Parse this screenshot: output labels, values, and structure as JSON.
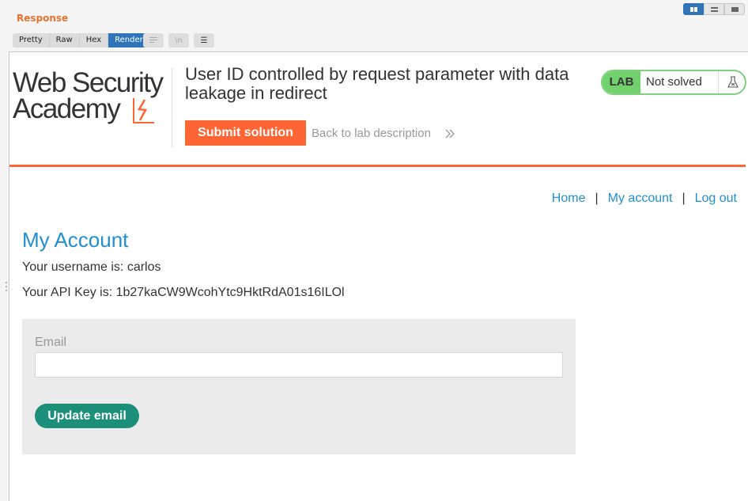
{
  "panel": {
    "title": "Response",
    "tabs": [
      "Pretty",
      "Raw",
      "Hex",
      "Render"
    ],
    "active_tab": "Render",
    "tool_icons": [
      "wrap-lines-icon",
      "newline-icon",
      "menu-icon"
    ],
    "tool_glyphs": {
      "newline": "\\n",
      "menu": "☰"
    },
    "view_icons": [
      "split-horizontal-icon",
      "split-vertical-icon",
      "single-pane-icon"
    ]
  },
  "lab": {
    "logo_line1": "Web Security",
    "logo_line2": "Academy",
    "title": "User ID controlled by request parameter with data leakage in redirect",
    "submit_label": "Submit solution",
    "back_label": "Back to lab description",
    "badge": "LAB",
    "status": "Not solved",
    "accent": "#ff6633",
    "badge_color": "#70d16d"
  },
  "nav": {
    "home": "Home",
    "separator": "|",
    "my_account": "My account",
    "log_out": "Log out"
  },
  "account": {
    "heading": "My Account",
    "username_line": "Your username is: carlos",
    "api_key_line": "Your API Key is: 1b27kaCW9WcohYtc9HktRdA01s16ILOl",
    "email_label": "Email",
    "email_value": "",
    "update_label": "Update email",
    "button_color": "#1b8f79"
  }
}
